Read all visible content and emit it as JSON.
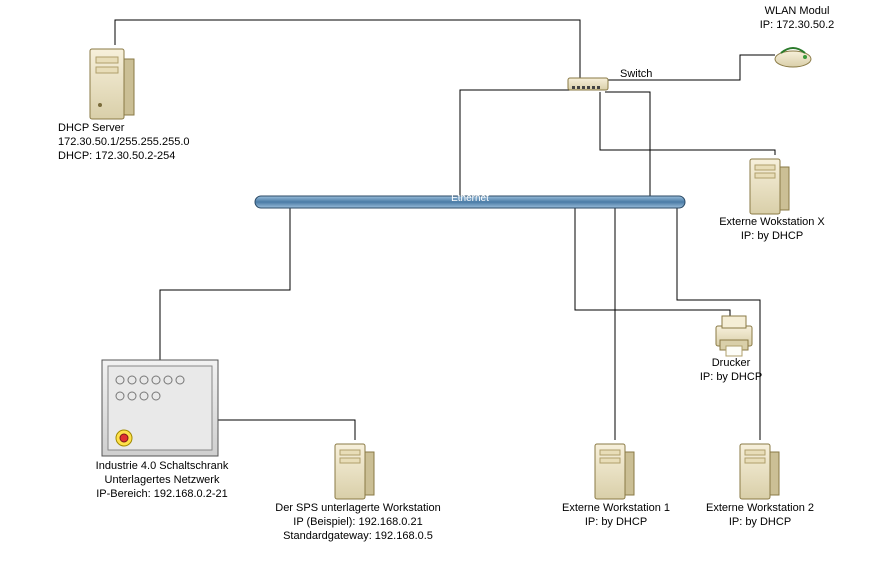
{
  "ethernet": {
    "label": "Ethernet"
  },
  "switch": {
    "label": "Switch"
  },
  "wlan": {
    "line1": "WLAN Modul",
    "line2": "IP: 172.30.50.2"
  },
  "dhcp_server": {
    "line1": "DHCP Server",
    "line2": "172.30.50.1/255.255.255.0",
    "line3": "DHCP: 172.30.50.2-254"
  },
  "ext_x": {
    "line1": "Externe Wokstation X",
    "line2": "IP: by DHCP"
  },
  "printer": {
    "line1": "Drucker",
    "line2": "IP: by DHCP"
  },
  "schaltschrank": {
    "line1": "Industrie 4.0 Schaltschrank",
    "line2": "Unterlagertes Netzwerk",
    "line3": "IP-Bereich: 192.168.0.2-21"
  },
  "sps_ws": {
    "line1": "Der SPS unterlagerte Workstation",
    "line2": "IP (Beispiel): 192.168.0.21",
    "line3": "Standardgateway: 192.168.0.5"
  },
  "ext1": {
    "line1": "Externe Workstation 1",
    "line2": "IP: by DHCP"
  },
  "ext2": {
    "line1": "Externe Workstation 2",
    "line2": "IP: by DHCP"
  }
}
